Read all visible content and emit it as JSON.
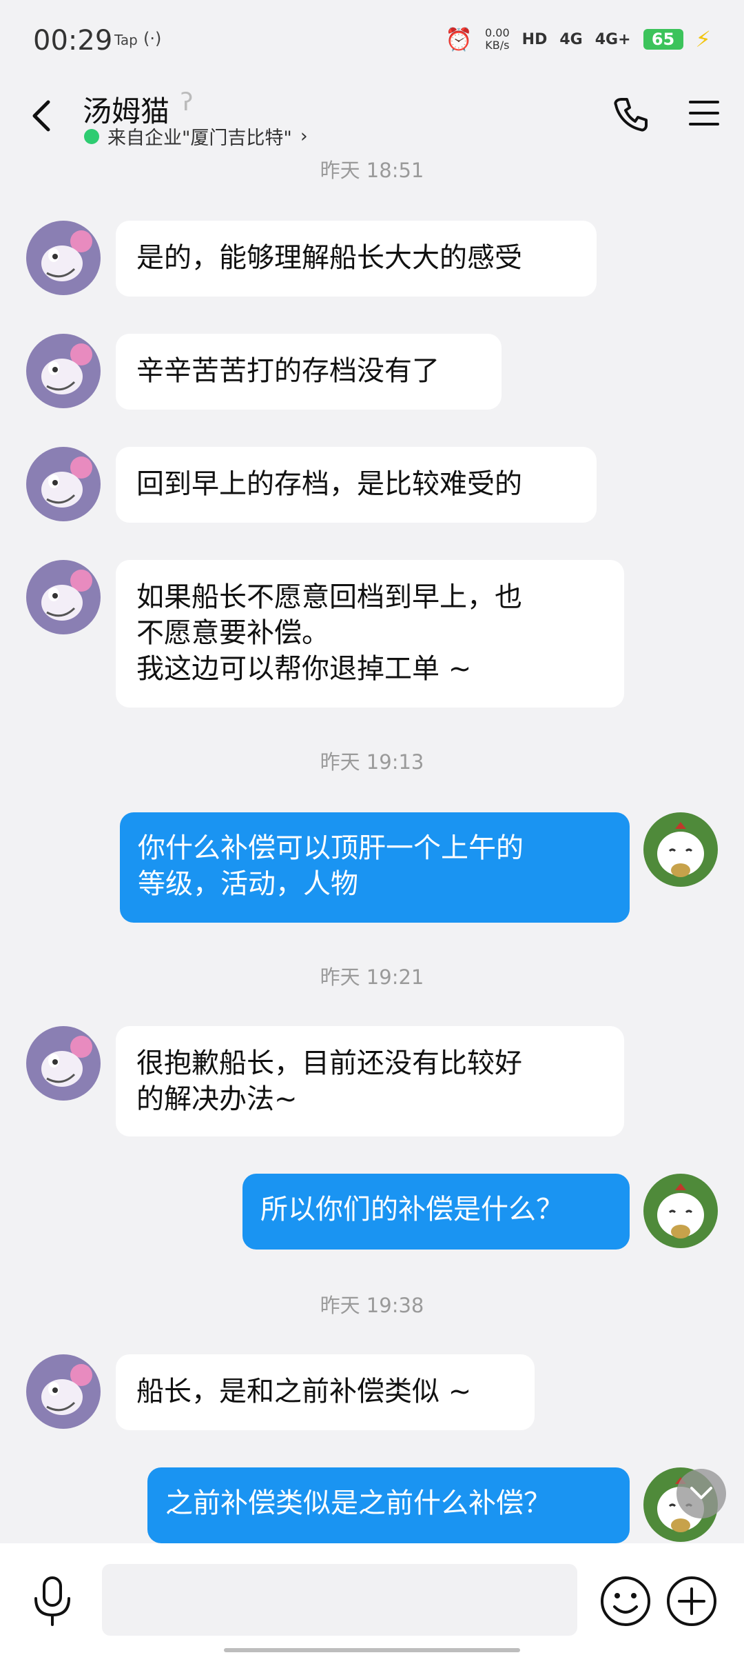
{
  "status_bar": {
    "time": "00:29",
    "tap_label": "Tap",
    "net_speed_value": "0.00",
    "net_speed_unit": "KB/s",
    "hd_label": "HD",
    "sim1_label": "4G",
    "sim2_label": "4G+",
    "battery_percent": "65"
  },
  "header": {
    "contact_name": "汤姆猫",
    "subtitle": "来自企业\"厦门吉比特\"",
    "subtitle_chevron": "›"
  },
  "messages": [
    {
      "type": "timestamp",
      "text": "昨天 18:51"
    },
    {
      "type": "incoming",
      "text": "是的，能够理解船长大大的感受"
    },
    {
      "type": "incoming",
      "text": "辛辛苦苦打的存档没有了"
    },
    {
      "type": "incoming",
      "text": "回到早上的存档，是比较难受的"
    },
    {
      "type": "incoming",
      "text": "如果船长不愿意回档到早上，也\n不愿意要补偿。\n我这边可以帮你退掉工单 ~"
    },
    {
      "type": "timestamp",
      "text": "昨天 19:13"
    },
    {
      "type": "outgoing",
      "text": "你什么补偿可以顶肝一个上午的\n等级，活动，人物"
    },
    {
      "type": "timestamp",
      "text": "昨天 19:21"
    },
    {
      "type": "incoming",
      "text": "很抱歉船长，目前还没有比较好\n的解决办法~"
    },
    {
      "type": "outgoing",
      "text": "所以你们的补偿是什么？"
    },
    {
      "type": "timestamp",
      "text": "昨天 19:38"
    },
    {
      "type": "incoming",
      "text": "船长，是和之前补偿类似 ~"
    },
    {
      "type": "outgoing",
      "text": "之前补偿类似是之前什么补偿？"
    }
  ],
  "input": {
    "placeholder": ""
  },
  "colors": {
    "outgoing_bubble": "#1a94f2",
    "incoming_bubble": "#ffffff",
    "background": "#f2f2f4",
    "online_dot": "#2ecc71"
  },
  "icons": [
    "back-icon",
    "ear-icon",
    "phone-icon",
    "menu-icon",
    "mic-icon",
    "emoji-icon",
    "plus-icon",
    "chevron-down-icon"
  ]
}
